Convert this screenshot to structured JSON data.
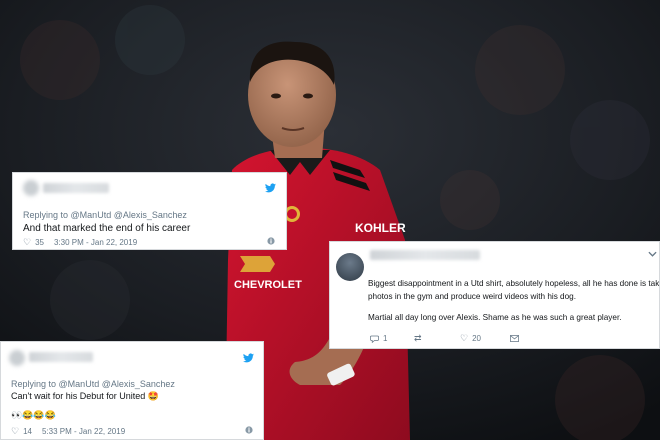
{
  "background": {
    "kit_sponsor": "KOHLER",
    "shirt_sponsor": "CHEVROLET"
  },
  "tweets": [
    {
      "reply_prefix": "Replying to",
      "reply_handles": "@ManUtd @Alexis_Sanchez",
      "text": "And that marked the end of his career",
      "likes": "35",
      "timestamp": "3:30 PM - Jan 22, 2019"
    },
    {
      "text_line1": "Biggest disappointment in a Utd shirt, absolutely hopeless, all he has done is take",
      "text_line2": "photos in the gym and produce weird videos with his dog.",
      "text_line3": "Martial all day long over Alexis. Shame as he was such a great player.",
      "replies": "1",
      "likes": "20"
    },
    {
      "reply_prefix": "Replying to",
      "reply_handles": "@ManUtd @Alexis_Sanchez",
      "text": "Can't wait for his Debut for United 🤩",
      "emoji_line": "👀😂😂😂",
      "likes": "14",
      "timestamp": "5:33 PM - Jan 22, 2019"
    }
  ],
  "colors": {
    "twitter_blue": "#1da1f2",
    "shirt_red": "#c8102e",
    "text_grey": "#657786"
  }
}
